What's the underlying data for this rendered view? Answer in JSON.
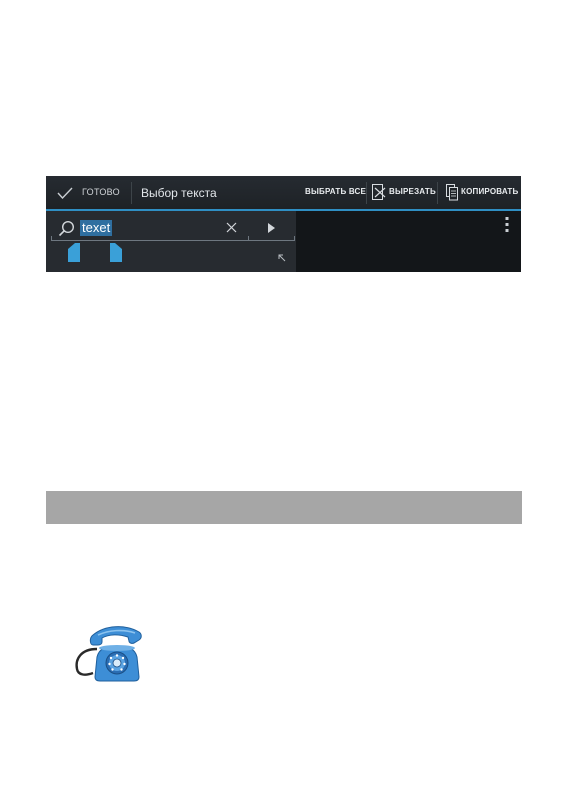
{
  "action_bar": {
    "done_label": "ГОТОВО",
    "title": "Выбор текста",
    "select_all_label": "ВЫБРАТЬ ВСЕ",
    "cut_label": "ВЫРЕЗАТЬ",
    "copy_label": "КОПИРОВАТЬ"
  },
  "editor": {
    "selected_text": "texet"
  },
  "icons": [
    "check-icon",
    "cut-icon",
    "copy-icon",
    "search-icon",
    "close-icon",
    "play-icon",
    "resize-icon",
    "overflow-menu-icon",
    "phone-icon"
  ],
  "colors": {
    "accent": "#2f8fc4",
    "selection": "#2f6fa0",
    "handle": "#3aa0d8",
    "gray_bar": "#a6a6a6",
    "phone": "#3d8ed6"
  }
}
